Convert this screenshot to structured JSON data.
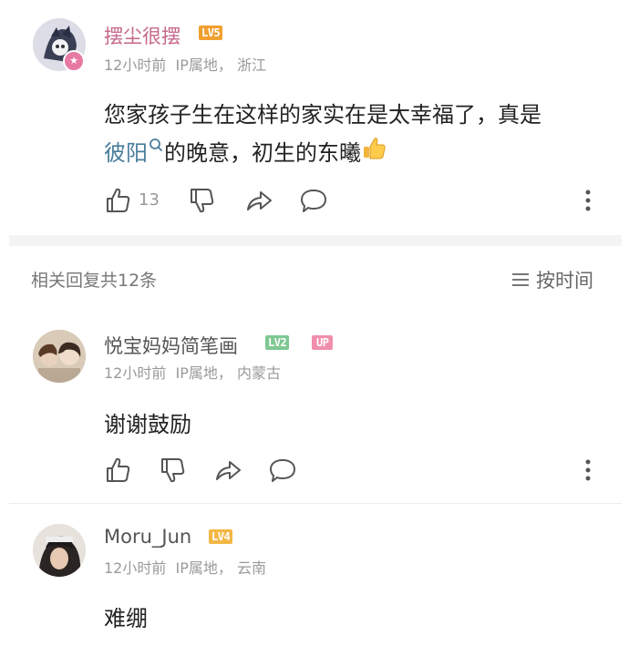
{
  "comment_main": {
    "username": "摆尘很摆",
    "level": "LV5",
    "time": "12小时前",
    "ip_label": "IP属地",
    "ip_sep": "，",
    "ip_region": "浙江",
    "text_line1": "您家孩子生在这样的家实在是太幸福了，真是",
    "text_link": "彼阳",
    "text_line2_rest": "的晚意，初生的东曦",
    "like_count": "13"
  },
  "replies_header": {
    "count_label": "相关回复共12条",
    "sort_label": "按时间"
  },
  "reply_1": {
    "username": "悦宝妈妈简笔画",
    "level": "LV2",
    "badge": "UP",
    "time": "12小时前",
    "ip_label": "IP属地",
    "ip_sep": "，",
    "ip_region": "内蒙古",
    "text": "谢谢鼓励"
  },
  "reply_2": {
    "username": "Moru_Jun",
    "level": "LV4",
    "time": "12小时前",
    "ip_label": "IP属地",
    "ip_sep": "，",
    "ip_region": "云南",
    "text": "难绷"
  },
  "colors": {
    "username_main": "#c6688b",
    "username_reply": "#555555",
    "lv5": "#f0a030",
    "lv2": "#7fc893",
    "lv4": "#f3b746",
    "up_badge": "#f08fab",
    "link": "#4a7d9c"
  },
  "icons": [
    "thumbs-up-icon",
    "thumbs-down-icon",
    "share-icon",
    "comment-icon",
    "more-vertical-icon",
    "search-icon",
    "thumbs-up-emoji",
    "sort-lines-icon"
  ]
}
